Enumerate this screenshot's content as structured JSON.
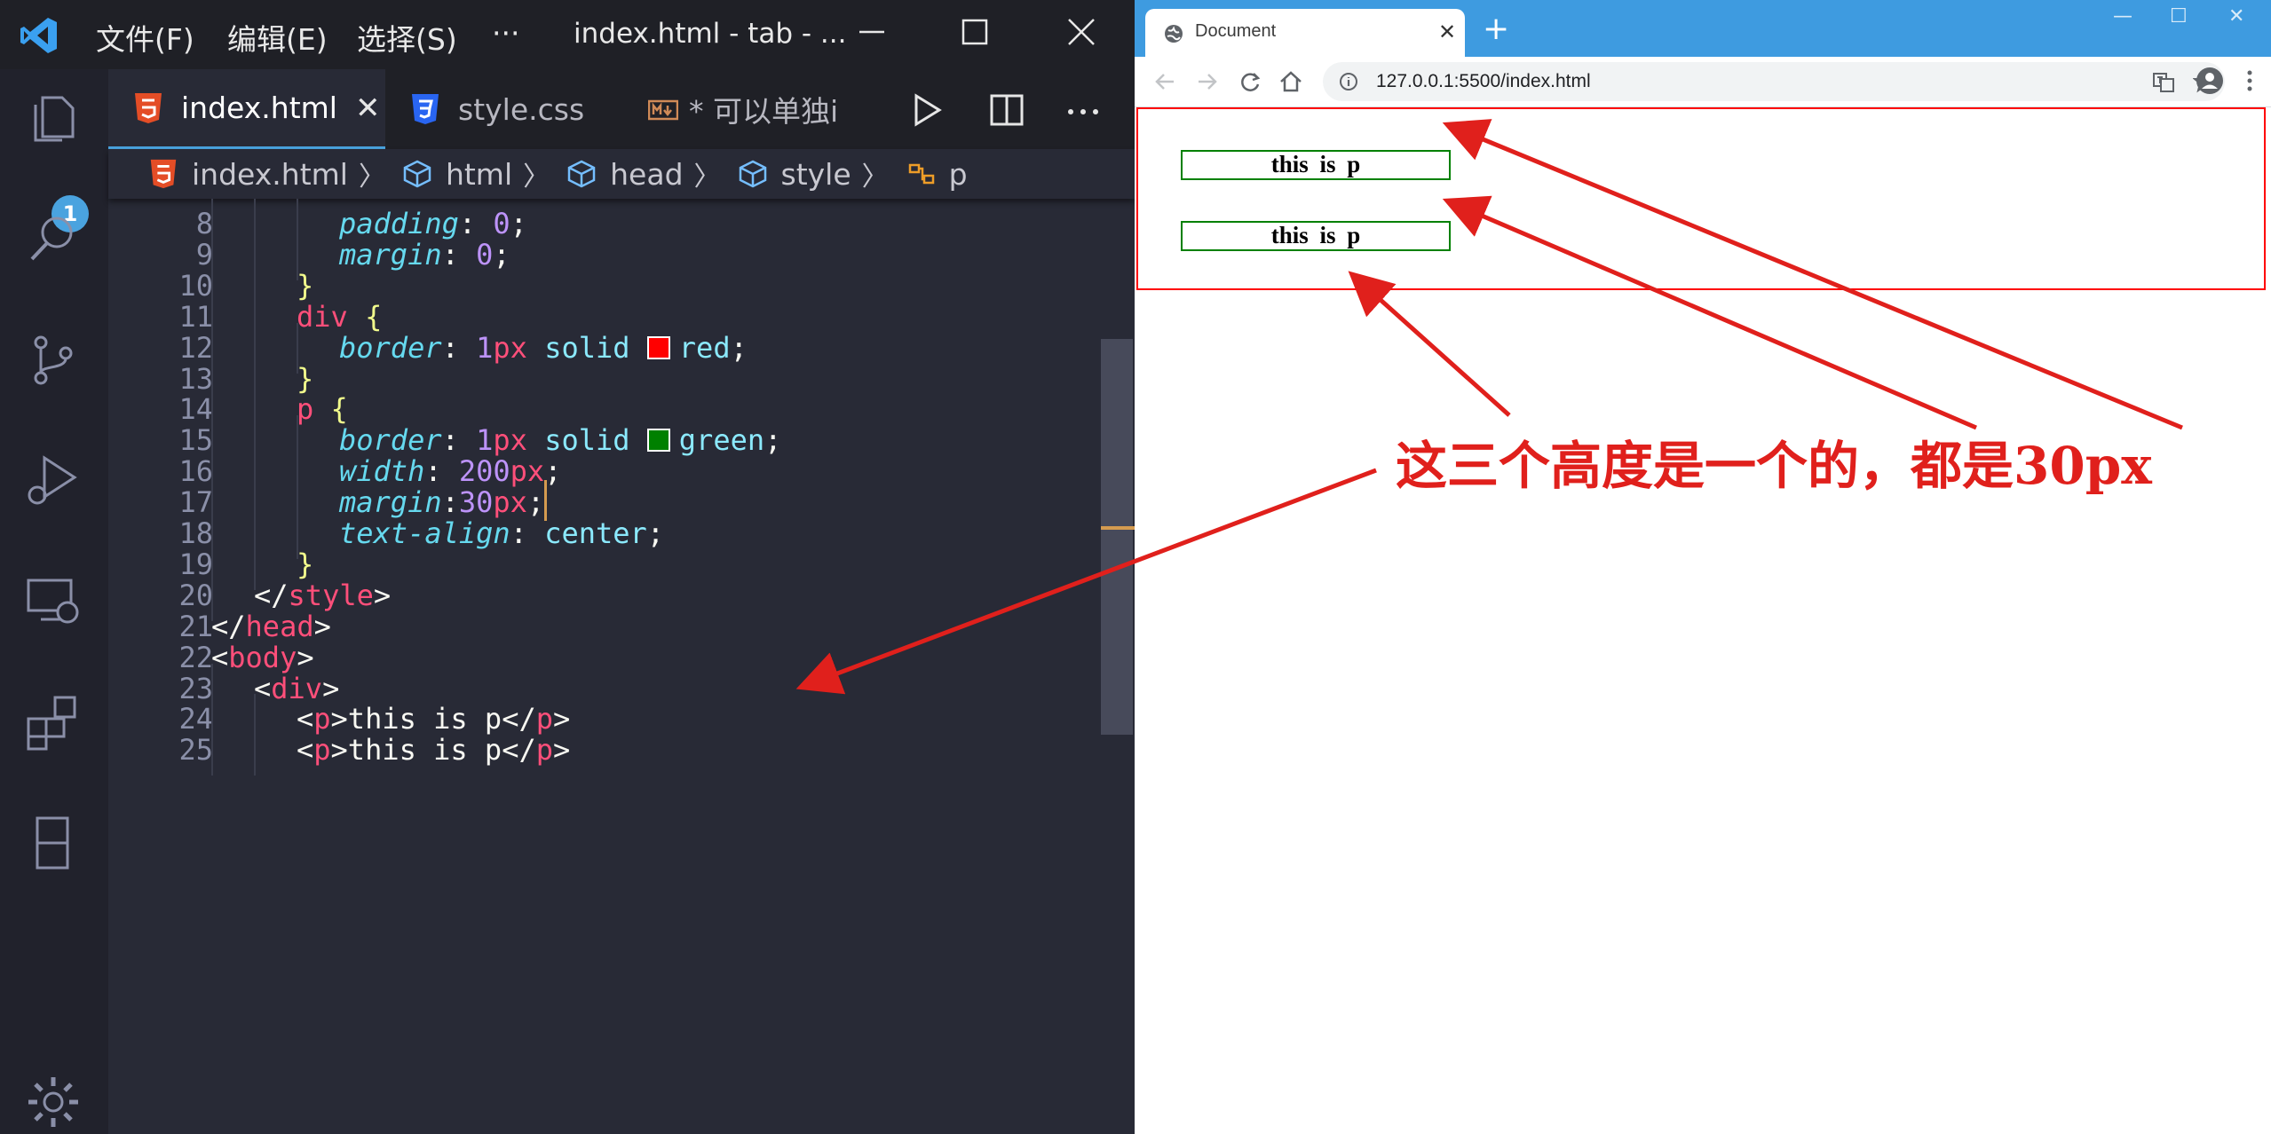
{
  "vscode": {
    "menu": [
      "文件(F)",
      "编辑(E)",
      "选择(S)",
      "···"
    ],
    "window_title": "index.html - tab - ...",
    "explorer_badge": "1",
    "tabs": [
      {
        "label": "index.html",
        "icon": "html5-icon",
        "active": true
      },
      {
        "label": "style.css",
        "icon": "css3-icon",
        "active": false
      },
      {
        "label": "* 可以单独i",
        "icon": "markdown-icon",
        "active": false
      }
    ],
    "breadcrumb": [
      "index.html",
      "html",
      "head",
      "style",
      "p"
    ],
    "lines": [
      {
        "n": "8",
        "tokens": [
          [
            "prop",
            "padding"
          ],
          [
            "punc",
            ": "
          ],
          [
            "num",
            "0"
          ],
          [
            "punc",
            ";"
          ]
        ],
        "indent": 4
      },
      {
        "n": "9",
        "tokens": [
          [
            "prop",
            "margin"
          ],
          [
            "punc",
            ": "
          ],
          [
            "num",
            "0"
          ],
          [
            "punc",
            ";"
          ]
        ],
        "indent": 4
      },
      {
        "n": "10",
        "tokens": [
          [
            "brace",
            "}"
          ]
        ],
        "indent": 3
      },
      {
        "n": "11",
        "tokens": [
          [
            "kw",
            "div"
          ],
          [
            "punc",
            " "
          ],
          [
            "brace",
            "{"
          ]
        ],
        "indent": 3
      },
      {
        "n": "12",
        "tokens": [
          [
            "prop",
            "border"
          ],
          [
            "punc",
            ": "
          ],
          [
            "num",
            "1"
          ],
          [
            "unit",
            "px"
          ],
          [
            "val",
            " solid "
          ],
          [
            "swatch",
            "#ff0000"
          ],
          [
            "val",
            "red"
          ],
          [
            "punc",
            ";"
          ]
        ],
        "indent": 4
      },
      {
        "n": "13",
        "tokens": [
          [
            "brace",
            "}"
          ]
        ],
        "indent": 3
      },
      {
        "n": "14",
        "tokens": [
          [
            "kw",
            "p"
          ],
          [
            "punc",
            " "
          ],
          [
            "brace",
            "{"
          ]
        ],
        "indent": 3
      },
      {
        "n": "15",
        "tokens": [
          [
            "prop",
            "border"
          ],
          [
            "punc",
            ": "
          ],
          [
            "num",
            "1"
          ],
          [
            "unit",
            "px"
          ],
          [
            "val",
            " solid "
          ],
          [
            "swatch",
            "#008000"
          ],
          [
            "val",
            "green"
          ],
          [
            "punc",
            ";"
          ]
        ],
        "indent": 4
      },
      {
        "n": "16",
        "tokens": [
          [
            "prop",
            "width"
          ],
          [
            "punc",
            ": "
          ],
          [
            "num",
            "200"
          ],
          [
            "unit",
            "px"
          ],
          [
            "punc",
            ";"
          ]
        ],
        "indent": 4
      },
      {
        "n": "17",
        "tokens": [
          [
            "prop",
            "margin"
          ],
          [
            "punc",
            ":"
          ],
          [
            "num",
            "30"
          ],
          [
            "unit",
            "px"
          ],
          [
            "punc",
            ";"
          ],
          [
            "cursor",
            ""
          ]
        ],
        "indent": 4
      },
      {
        "n": "18",
        "tokens": [
          [
            "prop",
            "text-align"
          ],
          [
            "punc",
            ": "
          ],
          [
            "val",
            "center"
          ],
          [
            "punc",
            ";"
          ]
        ],
        "indent": 4
      },
      {
        "n": "19",
        "tokens": [
          [
            "brace",
            "}"
          ]
        ],
        "indent": 3
      },
      {
        "n": "20",
        "tokens": [
          [
            "txt",
            "</"
          ],
          [
            "kw",
            "style"
          ],
          [
            "txt",
            ">"
          ]
        ],
        "indent": 2
      },
      {
        "n": "21",
        "tokens": [
          [
            "txt",
            "</"
          ],
          [
            "kw",
            "head"
          ],
          [
            "txt",
            ">"
          ]
        ],
        "indent": 1
      },
      {
        "n": "22",
        "tokens": [
          [
            "txt",
            "<"
          ],
          [
            "kw",
            "body"
          ],
          [
            "txt",
            ">"
          ]
        ],
        "indent": 1
      },
      {
        "n": "23",
        "tokens": [
          [
            "txt",
            "<"
          ],
          [
            "kw",
            "div"
          ],
          [
            "txt",
            ">"
          ]
        ],
        "indent": 2
      },
      {
        "n": "24",
        "tokens": [
          [
            "txt",
            "<"
          ],
          [
            "kw",
            "p"
          ],
          [
            "txt",
            ">this is p</"
          ],
          [
            "kw",
            "p"
          ],
          [
            "txt",
            ">"
          ]
        ],
        "indent": 3
      },
      {
        "n": "25",
        "tokens": [
          [
            "txt",
            "<"
          ],
          [
            "kw",
            "p"
          ],
          [
            "txt",
            ">this is p</"
          ],
          [
            "kw",
            "p"
          ],
          [
            "txt",
            ">"
          ]
        ],
        "indent": 3
      }
    ]
  },
  "browser": {
    "tab_title": "Document",
    "url": "127.0.0.1:5500/index.html",
    "paragraphs": [
      "this  is  p",
      "this  is  p"
    ]
  },
  "annotation": {
    "text": "这三个高度是一个的，都是30px",
    "color": "#e0201c"
  }
}
